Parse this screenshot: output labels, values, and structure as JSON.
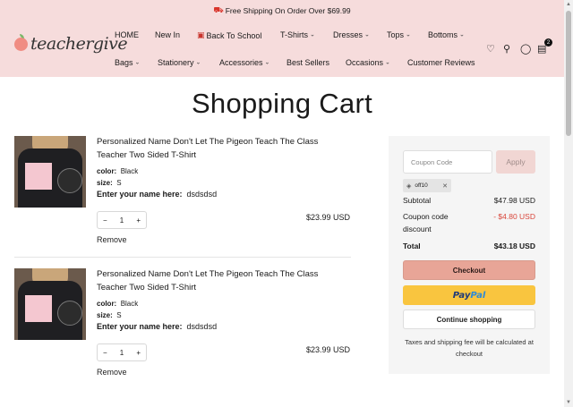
{
  "announcement": {
    "icon": "truck-icon",
    "text": "Free Shipping On Order Over $69.99"
  },
  "brand": {
    "name": "teachergive",
    "icon": "apple-icon"
  },
  "nav": {
    "row1": [
      {
        "label": "HOME",
        "dropdown": false
      },
      {
        "label": "New In",
        "dropdown": false
      },
      {
        "label": "Back To School",
        "dropdown": false,
        "icon": "school-bag-icon"
      },
      {
        "label": "T-Shirts",
        "dropdown": true
      },
      {
        "label": "Dresses",
        "dropdown": true
      },
      {
        "label": "Tops",
        "dropdown": true
      },
      {
        "label": "Bottoms",
        "dropdown": true
      }
    ],
    "row2": [
      {
        "label": "Bags",
        "dropdown": true
      },
      {
        "label": "Stationery",
        "dropdown": true
      },
      {
        "label": "Accessories",
        "dropdown": true
      },
      {
        "label": "Best Sellers",
        "dropdown": false
      },
      {
        "label": "Occasions",
        "dropdown": true
      },
      {
        "label": "Customer Reviews",
        "dropdown": false
      }
    ],
    "cart_count": "2"
  },
  "page_title": "Shopping Cart",
  "cart_items": [
    {
      "name": "Personalized Name Don't Let The Pigeon Teach The Class Teacher Two Sided T-Shirt",
      "color_label": "color:",
      "color": "Black",
      "size_label": "size:",
      "size": "S",
      "custom_label": "Enter your name here:",
      "custom_value": "dsdsdsd",
      "qty": "1",
      "price": "$23.99 USD",
      "remove": "Remove"
    },
    {
      "name": "Personalized Name Don't Let The Pigeon Teach The Class Teacher Two Sided T-Shirt",
      "color_label": "color:",
      "color": "Black",
      "size_label": "size:",
      "size": "S",
      "custom_label": "Enter your name here:",
      "custom_value": "dsdsdsd",
      "qty": "1",
      "price": "$23.99 USD",
      "remove": "Remove"
    }
  ],
  "summary": {
    "coupon_placeholder": "Coupon Code",
    "apply_label": "Apply",
    "applied_coupon": "off10",
    "subtotal_label": "Subtotal",
    "subtotal": "$47.98 USD",
    "discount_label": "Coupon code discount",
    "discount": "- $4.80 USD",
    "total_label": "Total",
    "total": "$43.18 USD",
    "checkout_label": "Checkout",
    "paypal_pay": "Pay",
    "paypal_pal": "Pal",
    "continue_label": "Continue shopping",
    "tax_note": "Taxes and shipping fee will be calculated at checkout"
  },
  "colors": {
    "header_bg": "#f6dcdc",
    "checkout_bg": "#e8a597",
    "paypal_bg": "#f9c53f",
    "discount": "#d9463b"
  }
}
